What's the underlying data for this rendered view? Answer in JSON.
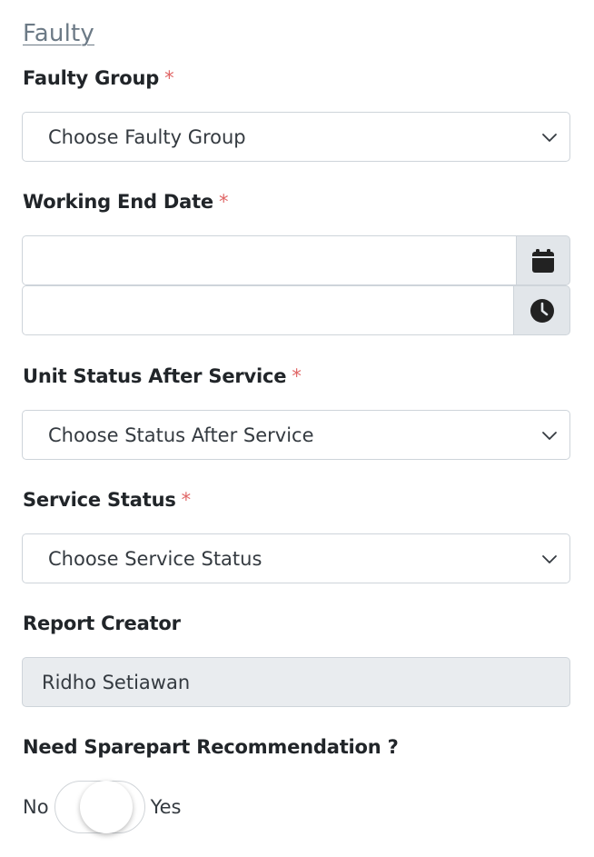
{
  "section": {
    "title": "Faulty"
  },
  "faulty_group": {
    "label": "Faulty Group",
    "required_mark": "*",
    "selected": "Choose Faulty Group"
  },
  "working_end_date": {
    "label": "Working End Date",
    "required_mark": "*",
    "date_value": "",
    "time_value": "",
    "date_icon": "calendar-icon",
    "time_icon": "clock-icon"
  },
  "unit_status_after_service": {
    "label": "Unit Status After Service",
    "required_mark": "*",
    "selected": "Choose Status After Service"
  },
  "service_status": {
    "label": "Service Status",
    "required_mark": "*",
    "selected": "Choose Service Status"
  },
  "report_creator": {
    "label": "Report Creator",
    "value": "Ridho Setiawan"
  },
  "sparepart_recommendation": {
    "label": "Need Sparepart Recommendation ?",
    "off_label": "No",
    "on_label": "Yes",
    "checked": false
  },
  "colors": {
    "required": "#e06666",
    "link": "#6c7a86",
    "addon_bg": "#e2e6ea",
    "readonly_bg": "#e9ecef"
  }
}
